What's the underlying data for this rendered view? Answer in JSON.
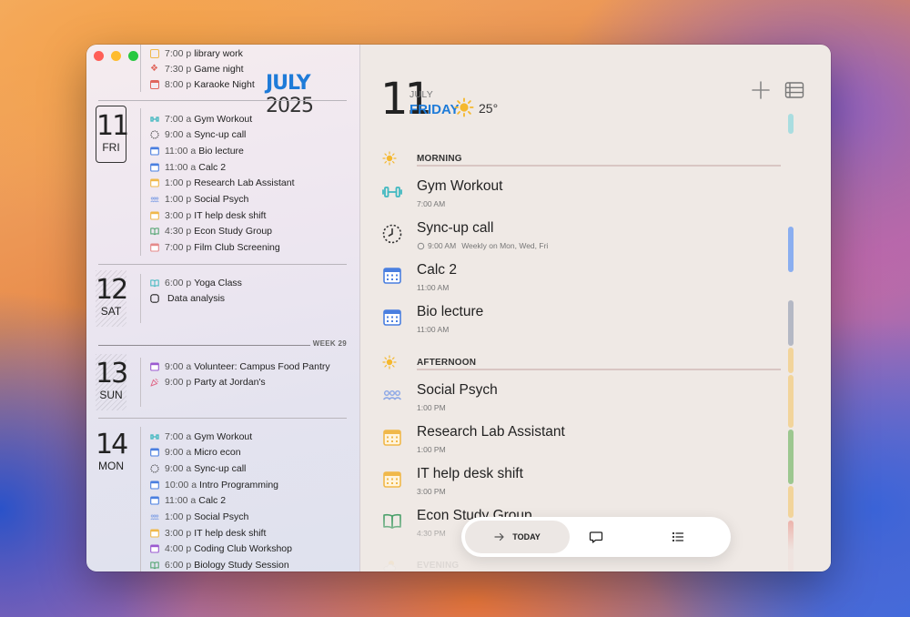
{
  "calendar": {
    "month": "JULY",
    "year": "2025"
  },
  "left_events_prev": [
    {
      "time": "7:00 p",
      "title": "library work",
      "color": "#f0b84a"
    },
    {
      "time": "7:30 p",
      "title": "Game night",
      "color": "#e0655c"
    },
    {
      "time": "8:00 p",
      "title": "Karaoke Night",
      "color": "#e0655c"
    }
  ],
  "days": [
    {
      "number": "11",
      "weekday": "FRI",
      "events": [
        {
          "time": "7:00 a",
          "title": "Gym Workout",
          "icon": "dumbbell-icon",
          "color": "#3fb8c0"
        },
        {
          "time": "9:00 a",
          "title": "Sync-up call",
          "icon": "dotted-circle-icon",
          "color": "#333333"
        },
        {
          "time": "11:00 a",
          "title": "Bio lecture",
          "icon": "calendar-icon",
          "color": "#4a7fe0"
        },
        {
          "time": "11:00 a",
          "title": "Calc 2",
          "icon": "calendar-icon",
          "color": "#4a7fe0"
        },
        {
          "time": "1:00 p",
          "title": "Research Lab Assistant",
          "icon": "calendar-icon",
          "color": "#f0b84a"
        },
        {
          "time": "1:00 p",
          "title": "Social Psych",
          "icon": "people-icon",
          "color": "#8aa6e6"
        },
        {
          "time": "3:00 p",
          "title": "IT help desk shift",
          "icon": "calendar-icon",
          "color": "#f0b84a"
        },
        {
          "time": "4:30 p",
          "title": "Econ Study Group",
          "icon": "book-icon",
          "color": "#4aa06a"
        },
        {
          "time": "7:00 p",
          "title": "Film Club Screening",
          "icon": "calendar-icon",
          "color": "#e58a8a"
        }
      ]
    },
    {
      "number": "12",
      "weekday": "SAT",
      "events": [
        {
          "time": "6:00 p",
          "title": "Yoga Class",
          "icon": "book-icon",
          "color": "#3fb8c0"
        },
        {
          "time": "",
          "title": "Data analysis",
          "icon": "rounded-square-icon",
          "color": "#222222"
        }
      ]
    },
    {
      "number": "13",
      "weekday": "SUN",
      "events": [
        {
          "time": "9:00 a",
          "title": "Volunteer: Campus Food Pantry",
          "icon": "calendar-icon",
          "color": "#9b59d0"
        },
        {
          "time": "9:00 p",
          "title": "Party at Jordan's",
          "icon": "party-icon",
          "color": "#e06a8a"
        }
      ]
    },
    {
      "number": "14",
      "weekday": "MON",
      "events": [
        {
          "time": "7:00 a",
          "title": "Gym Workout",
          "icon": "dumbbell-icon",
          "color": "#3fb8c0"
        },
        {
          "time": "9:00 a",
          "title": "Micro econ",
          "icon": "calendar-icon",
          "color": "#4a7fe0"
        },
        {
          "time": "9:00 a",
          "title": "Sync-up call",
          "icon": "dotted-circle-icon",
          "color": "#333333"
        },
        {
          "time": "10:00 a",
          "title": "Intro Programming",
          "icon": "calendar-icon",
          "color": "#4a7fe0"
        },
        {
          "time": "11:00 a",
          "title": "Calc 2",
          "icon": "calendar-icon",
          "color": "#4a7fe0"
        },
        {
          "time": "1:00 p",
          "title": "Social Psych",
          "icon": "people-icon",
          "color": "#8aa6e6"
        },
        {
          "time": "3:00 p",
          "title": "IT help desk shift",
          "icon": "calendar-icon",
          "color": "#f0b84a"
        },
        {
          "time": "4:00 p",
          "title": "Coding Club Workshop",
          "icon": "calendar-icon",
          "color": "#9b59d0"
        },
        {
          "time": "6:00 p",
          "title": "Biology Study Session",
          "icon": "book-icon",
          "color": "#4aa06a"
        }
      ]
    }
  ],
  "week_label": "WEEK 29",
  "detail": {
    "day": "11",
    "month": "JULY",
    "weekday": "FRIDAY",
    "temperature": "25°",
    "weather_icon": "sun-icon",
    "sections": [
      {
        "title": "MORNING",
        "icon": "sun-icon",
        "items": [
          {
            "title": "Gym Workout",
            "time": "7:00 AM",
            "icon": "dumbbell-icon"
          },
          {
            "title": "Sync-up call",
            "time": "9:00 AM",
            "repeat": "Weekly on Mon, Wed, Fri",
            "icon": "clock-dotted-icon"
          },
          {
            "title": "Calc 2",
            "time": "11:00 AM",
            "icon": "calendar-icon"
          },
          {
            "title": "Bio lecture",
            "time": "11:00 AM",
            "icon": "calendar-icon"
          }
        ]
      },
      {
        "title": "AFTERNOON",
        "icon": "sun-icon",
        "items": [
          {
            "title": "Social Psych",
            "time": "1:00 PM",
            "icon": "people-icon"
          },
          {
            "title": "Research Lab Assistant",
            "time": "1:00 PM",
            "icon": "calendar-icon"
          },
          {
            "title": "IT help desk shift",
            "time": "3:00 PM",
            "icon": "calendar-icon"
          },
          {
            "title": "Econ Study Group",
            "time": "4:30 PM",
            "icon": "book-icon"
          }
        ]
      },
      {
        "title": "EVENING",
        "icon": "cloud-sun-icon",
        "items": []
      }
    ]
  },
  "bottom_bar": {
    "today_label": "TODAY"
  },
  "colors": {
    "accent": "#1e7bd8",
    "teal": "#3fb8c0",
    "blue": "#4a7fe0",
    "amber": "#f0b84a",
    "green": "#4aa06a"
  }
}
